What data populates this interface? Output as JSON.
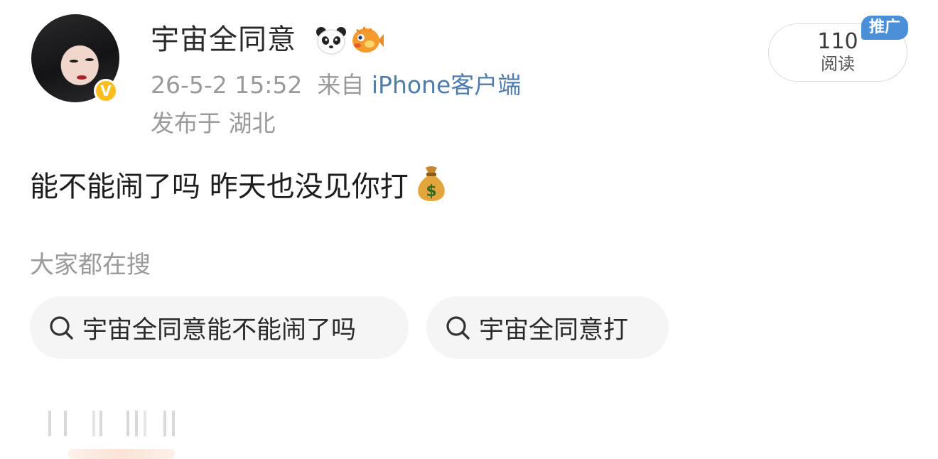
{
  "user": {
    "name": "宇宙全同意",
    "verified_badge": "V",
    "badge_icons": [
      "panda-icon",
      "fish-icon"
    ]
  },
  "meta": {
    "date": "26-5-2 15:52",
    "from_prefix": "来自",
    "source": "iPhone客户端",
    "location": "发布于 湖北"
  },
  "stats": {
    "read_count": "110",
    "read_label": "阅读",
    "promo_tag": "推广"
  },
  "post": {
    "text": "能不能闹了吗 昨天也没见你打",
    "emoji": "money-bag-icon"
  },
  "search": {
    "title": "大家都在搜",
    "chips": [
      "宇宙全同意能不能闹了吗",
      "宇宙全同意打"
    ]
  },
  "colors": {
    "link": "#4f7cab",
    "promo": "#4a8fd8",
    "verified": "#fbbe1c",
    "muted": "#9a9a9a"
  }
}
